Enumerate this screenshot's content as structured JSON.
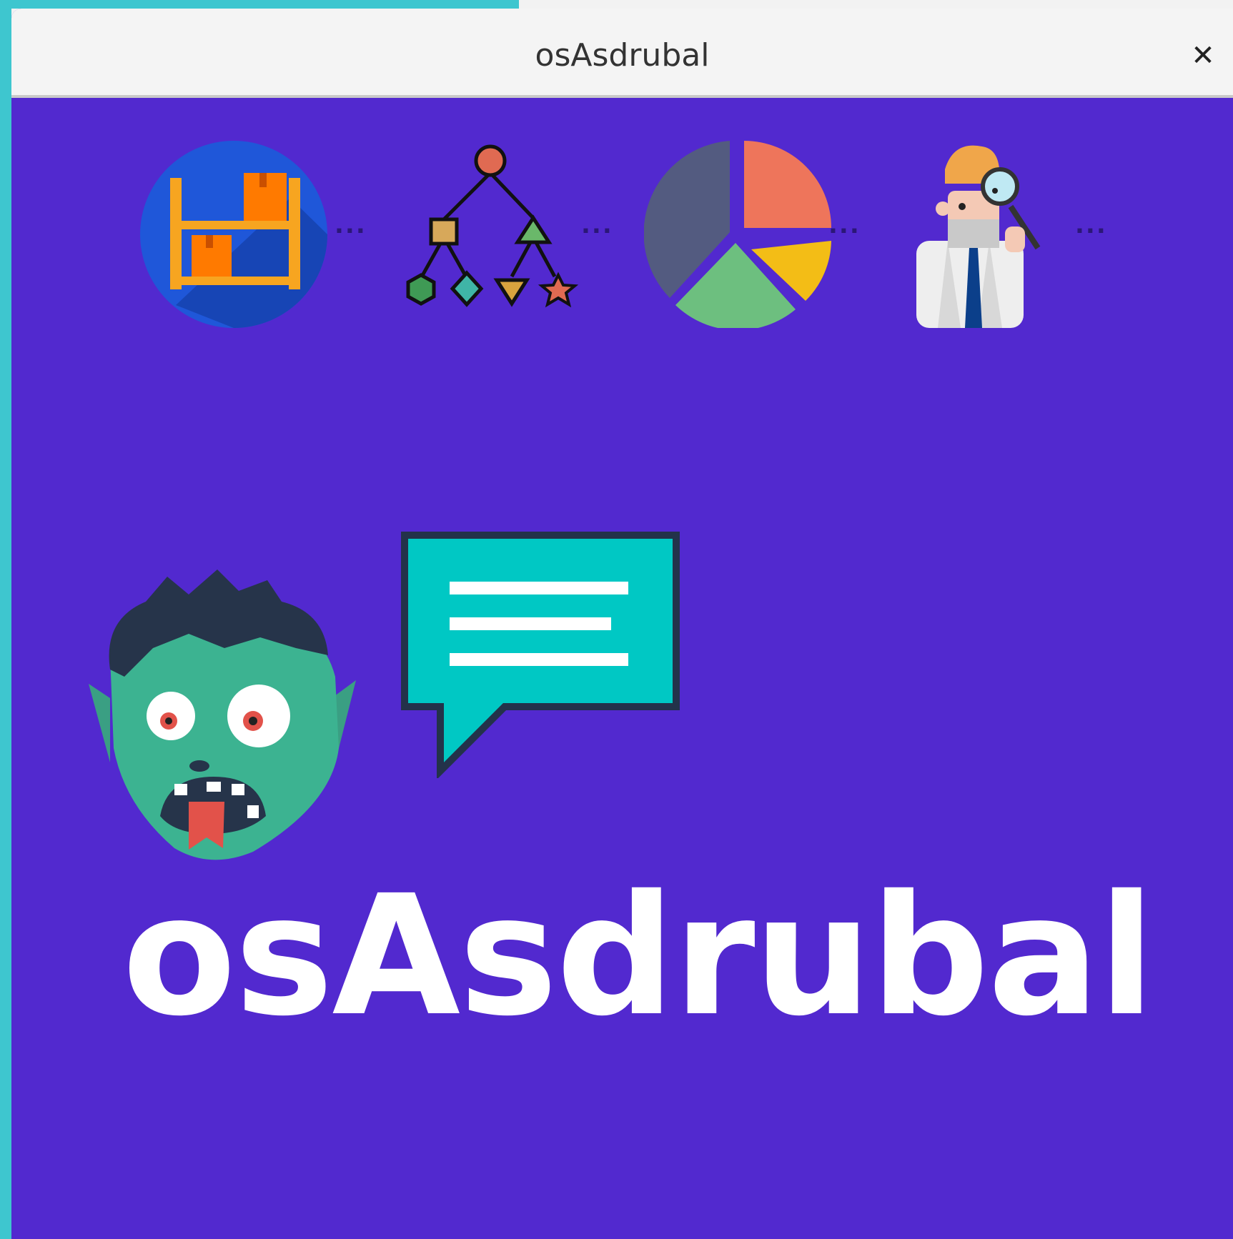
{
  "window": {
    "title": "osAsdrubal",
    "close_label": "✕"
  },
  "splash": {
    "logo_text": "osAsdrubal",
    "background_color": "#5229cf",
    "icons": [
      "warehouse-shelves-icon",
      "hierarchy-tree-icon",
      "pie-chart-icon",
      "detective-scientist-icon"
    ],
    "connector_text": "...",
    "mascot": "zombie-head-icon",
    "speech": "speech-bubble-icon"
  }
}
